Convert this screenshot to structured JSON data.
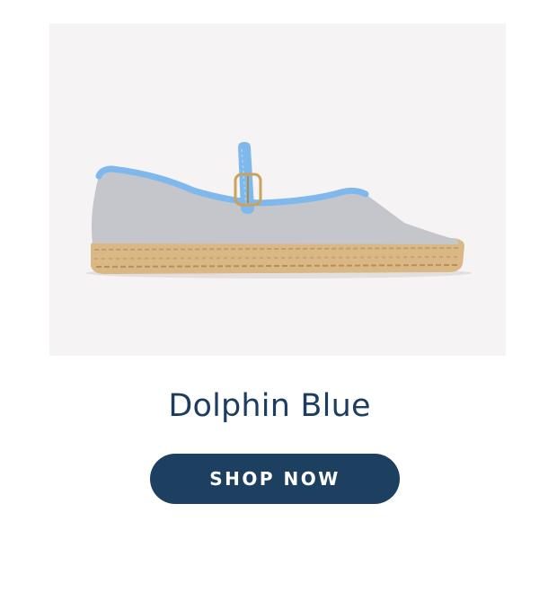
{
  "product": {
    "name": "Dolphin Blue",
    "image_subject": "shoe-icon"
  },
  "cta": {
    "label": "SHOP NOW"
  },
  "colors": {
    "image_background": "#f5f3f4",
    "name_text": "#1c3d5f",
    "button_background": "#1d3f60",
    "button_text": "#ffffff",
    "shoe_upper": "#c4c6cb",
    "shoe_trim": "#7fb8ec",
    "sole": "#d9b886"
  }
}
